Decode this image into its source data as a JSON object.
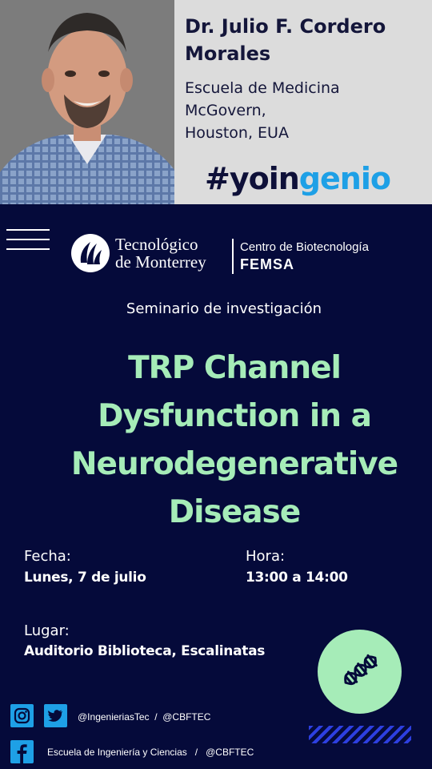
{
  "speaker": {
    "name": "Dr. Julio F. Cordero Morales",
    "affiliation": "Escuela de Medicina\nMcGovern,\nHouston, EUA",
    "hashtag_part1": "#yoin",
    "hashtag_part2": "genio"
  },
  "header": {
    "institution": "Tecnológico\nde Monterrey",
    "center": "Centro de Biotecnología",
    "center_brand": "FEMSA"
  },
  "event": {
    "kind": "Seminario de investigación",
    "title": "TRP Channel Dysfunction in a Neurodegenerative Disease",
    "date_label": "Fecha:",
    "date_value": "Lunes, 7 de julio",
    "time_label": "Hora:",
    "time_value": "13:00 a 14:00",
    "place_label": "Lugar:",
    "place_value": "Auditorio Biblioteca, Escalinatas"
  },
  "footer": {
    "twitter_instagram_handles": "@IngenieriasTec  /  @CBFTEC",
    "facebook_handles": "Escuela de Ingeniería y Ciencias   /   @CBFTEC"
  },
  "colors": {
    "background": "#050a3a",
    "accent_green": "#a6ecb8",
    "accent_blue": "#1ea0e6",
    "top_panel": "#dcdcdc"
  },
  "icons": [
    "menu-icon",
    "tec-emblem-icon",
    "dna-icon",
    "instagram-icon",
    "twitter-icon",
    "facebook-icon"
  ]
}
